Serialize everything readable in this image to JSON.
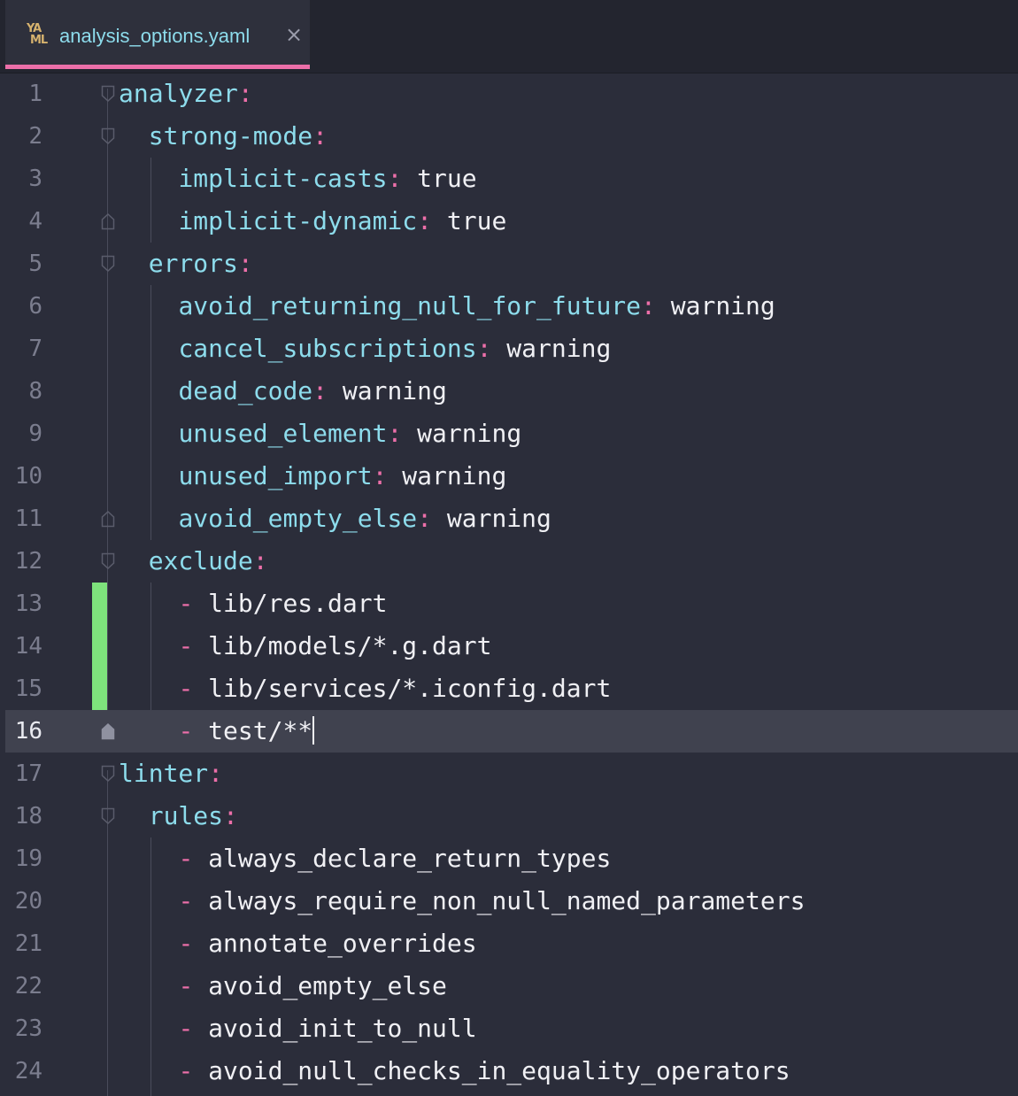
{
  "tab": {
    "icon_line1": "YA",
    "icon_line2": "ML",
    "title": "analysis_options.yaml",
    "close_glyph": "×"
  },
  "editor": {
    "current_line": 16,
    "lines": [
      {
        "num": "1",
        "key": "analyzer",
        "colon": ":",
        "value": ""
      },
      {
        "num": "2",
        "key": "strong-mode",
        "colon": ":",
        "value": ""
      },
      {
        "num": "3",
        "key": "implicit-casts",
        "colon": ":",
        "value": " true"
      },
      {
        "num": "4",
        "key": "implicit-dynamic",
        "colon": ":",
        "value": " true"
      },
      {
        "num": "5",
        "key": "errors",
        "colon": ":",
        "value": ""
      },
      {
        "num": "6",
        "key": "avoid_returning_null_for_future",
        "colon": ":",
        "value": " warning"
      },
      {
        "num": "7",
        "key": "cancel_subscriptions",
        "colon": ":",
        "value": " warning"
      },
      {
        "num": "8",
        "key": "dead_code",
        "colon": ":",
        "value": " warning"
      },
      {
        "num": "9",
        "key": "unused_element",
        "colon": ":",
        "value": " warning"
      },
      {
        "num": "10",
        "key": "unused_import",
        "colon": ":",
        "value": " warning"
      },
      {
        "num": "11",
        "key": "avoid_empty_else",
        "colon": ":",
        "value": " warning"
      },
      {
        "num": "12",
        "key": "exclude",
        "colon": ":",
        "value": ""
      },
      {
        "num": "13",
        "dash": "- ",
        "value": "lib/res.dart"
      },
      {
        "num": "14",
        "dash": "- ",
        "value": "lib/models/*.g.dart"
      },
      {
        "num": "15",
        "dash": "- ",
        "value": "lib/services/*.iconfig.dart"
      },
      {
        "num": "16",
        "dash": "- ",
        "value": "test/**"
      },
      {
        "num": "17",
        "key": "linter",
        "colon": ":",
        "value": ""
      },
      {
        "num": "18",
        "key": "rules",
        "colon": ":",
        "value": ""
      },
      {
        "num": "19",
        "dash": "- ",
        "value": "always_declare_return_types"
      },
      {
        "num": "20",
        "dash": "- ",
        "value": "always_require_non_null_named_parameters"
      },
      {
        "num": "21",
        "dash": "- ",
        "value": "annotate_overrides"
      },
      {
        "num": "22",
        "dash": "- ",
        "value": "avoid_empty_else"
      },
      {
        "num": "23",
        "dash": "- ",
        "value": "avoid_init_to_null"
      },
      {
        "num": "24",
        "dash": "- ",
        "value": "avoid_null_checks_in_equality_operators"
      }
    ]
  },
  "colors": {
    "key": "#8ddcec",
    "punctuation": "#ec6fa9",
    "value": "#f0f0f4",
    "git_added": "#7ee37c",
    "tab_accent": "#ec6fa9",
    "background": "#2b2d3a"
  }
}
